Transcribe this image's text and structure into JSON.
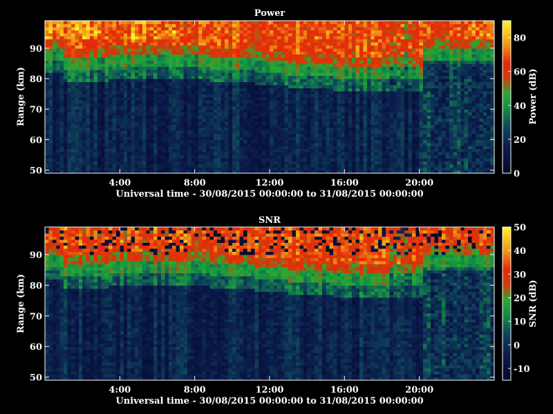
{
  "chart_data": [
    {
      "type": "heatmap",
      "title": "Power",
      "xlabel": "Universal time - 30/08/2015 00:00:00 to 31/08/2015 00:00:00",
      "ylabel": "Range (km)",
      "xlim": [
        0,
        24
      ],
      "ylim": [
        49,
        99
      ],
      "x_ticks": [
        "4:00",
        "8:00",
        "12:00",
        "16:00",
        "20:00"
      ],
      "x_tick_values": [
        4,
        8,
        12,
        16,
        20
      ],
      "y_ticks": [
        50,
        60,
        70,
        80,
        90
      ],
      "colorbar": {
        "label": "Power (dB)",
        "range": [
          0,
          90
        ],
        "ticks": [
          0,
          20,
          40,
          60,
          80
        ]
      },
      "rows_range_km": [
        99,
        49
      ],
      "time_resolution_h": 0.2,
      "description_profile_db": {
        "below_75km": 8,
        "at_80km": 15,
        "at_85km": 40,
        "above_90km": 70
      }
    },
    {
      "type": "heatmap",
      "title": "SNR",
      "xlabel": "Universal time - 30/08/2015 00:00:00 to 31/08/2015 00:00:00",
      "ylabel": "Range (km)",
      "xlim": [
        0,
        24
      ],
      "ylim": [
        49,
        99
      ],
      "x_ticks": [
        "4:00",
        "8:00",
        "12:00",
        "16:00",
        "20:00"
      ],
      "x_tick_values": [
        4,
        8,
        12,
        16,
        20
      ],
      "y_ticks": [
        50,
        60,
        70,
        80,
        90
      ],
      "colorbar": {
        "label": "SNR (dB)",
        "range": [
          -15,
          50
        ],
        "ticks": [
          -10,
          0,
          10,
          20,
          30,
          40,
          50
        ]
      },
      "rows_range_km": [
        99,
        49
      ],
      "time_resolution_h": 0.2,
      "description_profile_db": {
        "below_75km": -10,
        "at_80km": -5,
        "at_85km": 12,
        "above_90km": 28
      }
    }
  ]
}
